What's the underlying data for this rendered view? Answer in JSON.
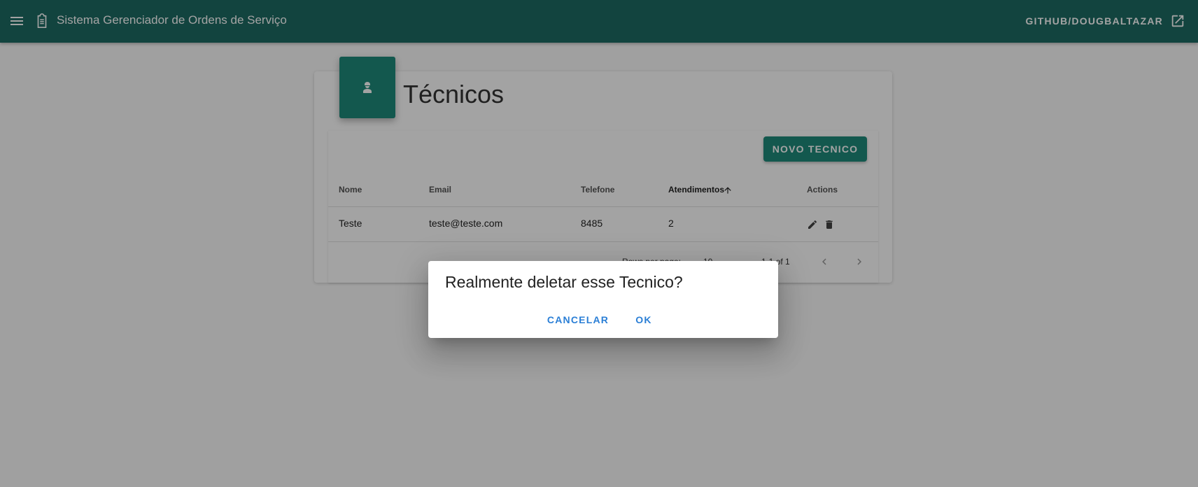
{
  "appbar": {
    "title": "Sistema Gerenciador de Ordens de Serviço",
    "link_label": "GITHUB/DOUGBALTAZAR"
  },
  "page": {
    "title": "Técnicos",
    "new_button": "NOVO TECNICO"
  },
  "table": {
    "columns": [
      "Nome",
      "Email",
      "Telefone",
      "Atendimentos",
      "Actions"
    ],
    "sorted_column": "Atendimentos",
    "rows": [
      {
        "nome": "Teste",
        "email": "teste@teste.com",
        "telefone": "8485",
        "atendimentos": "2"
      }
    ],
    "pagination": {
      "rows_label": "Rows per page:",
      "rows_value": "10",
      "range": "1-1 of 1"
    }
  },
  "dialog": {
    "title": "Realmente deletar esse Tecnico?",
    "cancel_label": "CANCELAR",
    "ok_label": "OK"
  },
  "colors": {
    "appbar": "#1d6b63",
    "primary": "#1f8a7a",
    "dialog_action": "#2b7fd6"
  },
  "icons": [
    "menu-icon",
    "clipboard-icon",
    "open-in-new-icon",
    "engineer-icon",
    "arrow-up-icon",
    "pencil-icon",
    "trash-icon",
    "chevron-left-icon",
    "chevron-right-icon"
  ]
}
